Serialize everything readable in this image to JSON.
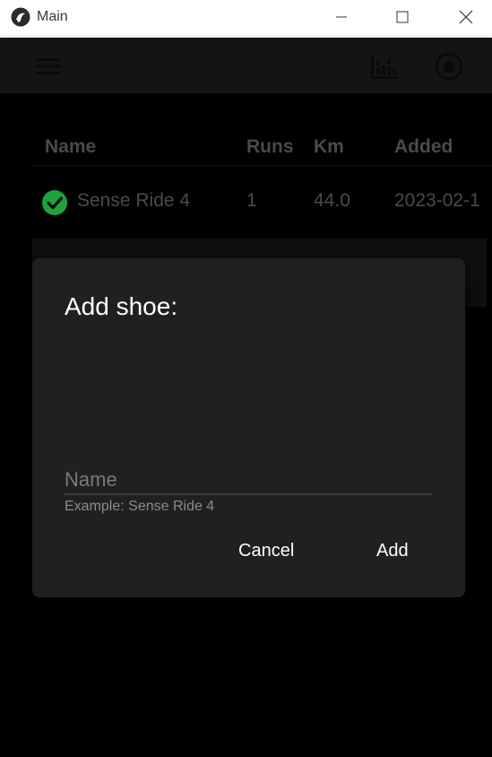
{
  "window": {
    "title": "Main"
  },
  "toolbar": {
    "menu_icon": "hamburger-menu-icon",
    "stats_icon": "bar-chart-icon",
    "home_icon": "home-icon"
  },
  "table": {
    "headers": [
      "Name",
      "Runs",
      "Km",
      "Added"
    ],
    "rows": [
      {
        "status_icon": "check-circle-icon",
        "status_color": "#1fa33b",
        "name": "Sense Ride 4",
        "runs": "1",
        "km": "44.0",
        "added": "2023-02-1"
      }
    ]
  },
  "dialog": {
    "title": "Add shoe:",
    "name_placeholder": "Name",
    "name_value": "",
    "helper": "Example: Sense Ride 4",
    "cancel_label": "Cancel",
    "add_label": "Add"
  }
}
